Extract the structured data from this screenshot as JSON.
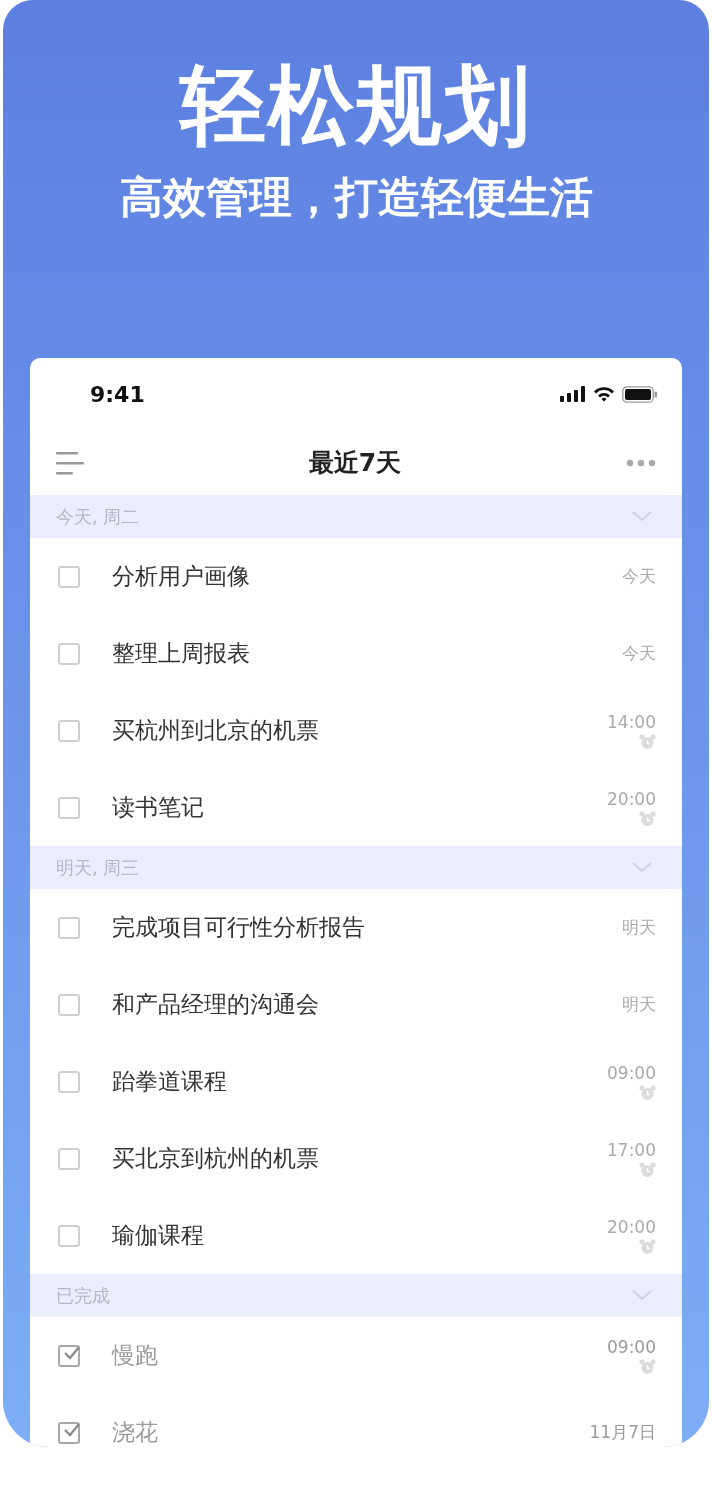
{
  "headline": "轻松规划",
  "subtitle": "高效管理，打造轻便生活",
  "status_bar": {
    "time": "9:41"
  },
  "nav": {
    "title": "最近7天"
  },
  "sections": [
    {
      "label": "今天, 周二",
      "tasks": [
        {
          "title": "分析用户画像",
          "checked": false,
          "due": "今天",
          "alarm": false
        },
        {
          "title": "整理上周报表",
          "checked": false,
          "due": "今天",
          "alarm": false
        },
        {
          "title": "买杭州到北京的机票",
          "checked": false,
          "due": "14:00",
          "alarm": true
        },
        {
          "title": "读书笔记",
          "checked": false,
          "due": "20:00",
          "alarm": true
        }
      ]
    },
    {
      "label": "明天, 周三",
      "tasks": [
        {
          "title": "完成项目可行性分析报告",
          "checked": false,
          "due": "明天",
          "alarm": false
        },
        {
          "title": "和产品经理的沟通会",
          "checked": false,
          "due": "明天",
          "alarm": false
        },
        {
          "title": "跆拳道课程",
          "checked": false,
          "due": "09:00",
          "alarm": true
        },
        {
          "title": "买北京到杭州的机票",
          "checked": false,
          "due": "17:00",
          "alarm": true
        },
        {
          "title": "瑜伽课程",
          "checked": false,
          "due": "20:00",
          "alarm": true
        }
      ]
    },
    {
      "label": "已完成",
      "tasks": [
        {
          "title": "慢跑",
          "checked": true,
          "due": "09:00",
          "alarm": true
        },
        {
          "title": "浇花",
          "checked": true,
          "due": "11月7日",
          "alarm": false
        }
      ]
    }
  ]
}
